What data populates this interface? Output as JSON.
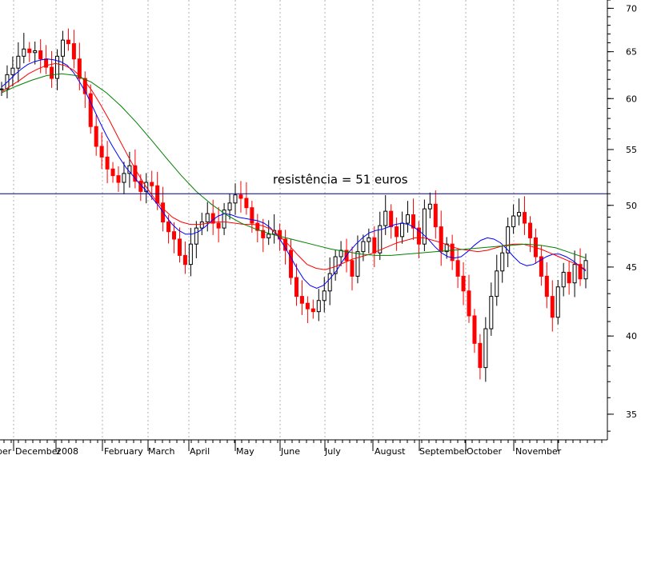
{
  "chart_data": {
    "type": "candlestick",
    "annotation": "resistência = 51 euros",
    "resistance_level": 51,
    "y_axis": {
      "min": 33.5,
      "max": 71,
      "scale": "log",
      "ticks": [
        35,
        40,
        45,
        50,
        55,
        60,
        65,
        70
      ]
    },
    "x_axis": {
      "labels": [
        "ber",
        "December",
        "2008",
        "February",
        "March",
        "April",
        "May",
        "June",
        "July",
        "August",
        "September",
        "October",
        "November"
      ]
    },
    "grid": "vertical dashed",
    "colors": {
      "up_candle": "#000000",
      "down_candle": "#ff0000",
      "ma_short": "#0000ff",
      "ma_medium": "#ff0000",
      "ma_long": "#008000",
      "resistance": "#000080"
    },
    "series": [
      {
        "color": "#000000",
        "values": [
          61,
          62.5,
          63.2,
          64.5,
          65.3,
          64.9,
          65.1,
          64.2,
          63.3,
          62.1,
          64.5,
          66.3,
          65.9,
          64.2,
          62.1,
          60.5,
          57.2,
          55.3,
          54.3,
          53.2,
          52.6,
          52.0,
          52.8,
          53.5,
          52.1,
          51.2,
          52.0,
          51.7,
          50.2,
          48.6,
          47.8,
          47.2,
          45.9,
          45.2,
          46.8,
          48.1,
          48.6,
          49.3,
          48.5,
          48.1,
          49.6,
          50.2,
          50.9,
          50.6,
          49.8,
          48.5,
          47.9,
          47.3,
          47.6,
          47.9,
          47.2,
          46.3,
          44.2,
          42.8,
          42.3,
          41.9,
          41.7,
          42.5,
          43.2,
          44.5,
          45.8,
          46.3,
          45.5,
          44.3,
          46.2,
          47.0,
          47.3,
          46.1,
          48.3,
          49.5,
          48.2,
          47.4,
          48.5,
          49.2,
          48.1,
          46.8,
          49.7,
          50.1,
          48.2,
          46.2,
          46.8,
          45.5,
          44.3,
          43.2,
          41.4,
          39.5,
          37.9,
          40.5,
          42.8,
          44.7,
          46.1,
          48.2,
          49.1,
          49.4,
          48.5,
          47.3,
          45.8,
          44.3,
          42.8,
          41.3,
          43.5,
          44.6,
          43.8,
          45.2,
          44.1,
          45.5
        ]
      },
      {
        "color": "#0000ff",
        "values": [
          61.2,
          61.8,
          62.5,
          63.1,
          63.6,
          63.9,
          64.1,
          64.2,
          64.1,
          63.9,
          63.5,
          62.7,
          61.6,
          60.4,
          59.0,
          57.6,
          56.3,
          55.2,
          54.2,
          53.3,
          52.6,
          51.9,
          51.3,
          50.6,
          49.9,
          49.1,
          48.4,
          47.9,
          47.6,
          47.6,
          47.8,
          48.2,
          48.7,
          49.1,
          49.3,
          49.2,
          49.0,
          48.9,
          48.8,
          48.7,
          48.5,
          48.1,
          47.5,
          46.7,
          45.8,
          44.9,
          44.1,
          43.6,
          43.4,
          43.6,
          44.1,
          44.7,
          45.5,
          46.2,
          46.8,
          47.3,
          47.7,
          47.9,
          48.0,
          48.2,
          48.4,
          48.5,
          48.4,
          48.1,
          47.7,
          47.2,
          46.6,
          46.1,
          45.8,
          45.7,
          45.8,
          46.2,
          46.7,
          47.1,
          47.3,
          47.2,
          46.9,
          46.4,
          45.8,
          45.3,
          45.1,
          45.2,
          45.5,
          45.8,
          46.0,
          46.0,
          45.8,
          45.5,
          45.1,
          44.7
        ]
      },
      {
        "color": "#ff0000",
        "values": [
          60.7,
          61.3,
          61.9,
          62.6,
          63.1,
          63.5,
          63.7,
          63.5,
          63.0,
          62.1,
          60.9,
          59.4,
          57.8,
          56.1,
          54.5,
          53.0,
          51.7,
          50.6,
          49.7,
          49.0,
          48.6,
          48.4,
          48.4,
          48.5,
          48.6,
          48.6,
          48.5,
          48.4,
          48.4,
          48.3,
          48.0,
          47.4,
          46.7,
          45.9,
          45.2,
          44.9,
          44.8,
          45.0,
          45.3,
          45.6,
          45.8,
          46.0,
          46.3,
          46.6,
          46.9,
          47.1,
          47.3,
          47.3,
          47.1,
          46.9,
          46.6,
          46.4,
          46.3,
          46.2,
          46.3,
          46.5,
          46.7,
          46.8,
          46.8,
          46.6,
          46.4,
          46.1,
          45.8,
          45.5,
          45.2,
          44.8
        ]
      },
      {
        "color": "#008000",
        "values": [
          60.6,
          61.3,
          61.9,
          62.4,
          62.6,
          62.4,
          61.7,
          60.6,
          59.2,
          57.6,
          55.9,
          54.2,
          52.6,
          51.2,
          50.1,
          49.2,
          48.5,
          48.0,
          47.6,
          47.3,
          47.0,
          46.7,
          46.4,
          46.2,
          46.0,
          45.9,
          45.9,
          46.0,
          46.1,
          46.2,
          46.3,
          46.4,
          46.5,
          46.6,
          46.7,
          46.8,
          46.7,
          46.5,
          46.1,
          45.7
        ]
      }
    ]
  }
}
